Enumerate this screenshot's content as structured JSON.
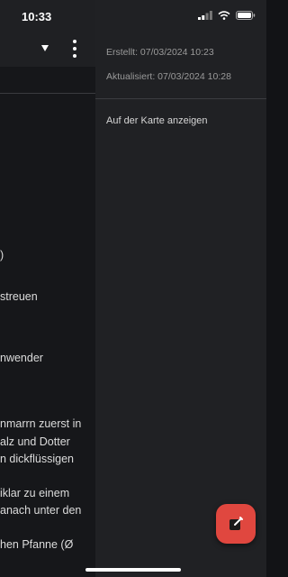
{
  "status_bar": {
    "time": "10:33"
  },
  "left_panel": {
    "fragments": [
      ")",
      "streuen",
      "nwender",
      "nmarrn zuerst in",
      "alz und Dotter",
      "n dickflüssigen",
      "iklar zu einem",
      "anach unter den",
      "hen Pfanne (Ø"
    ]
  },
  "drawer": {
    "created": "Erstellt: 07/03/2024 10:23",
    "updated": "Aktualisiert: 07/03/2024 10:28",
    "map_link": "Auf der Karte anzeigen"
  },
  "colors": {
    "accent": "#e0473f",
    "drawer_bg": "#202124",
    "page_bg": "#121316"
  },
  "icons": {
    "dropdown": "triangle-down-icon",
    "menu": "kebab-menu-icon",
    "fab": "edit-icon"
  }
}
